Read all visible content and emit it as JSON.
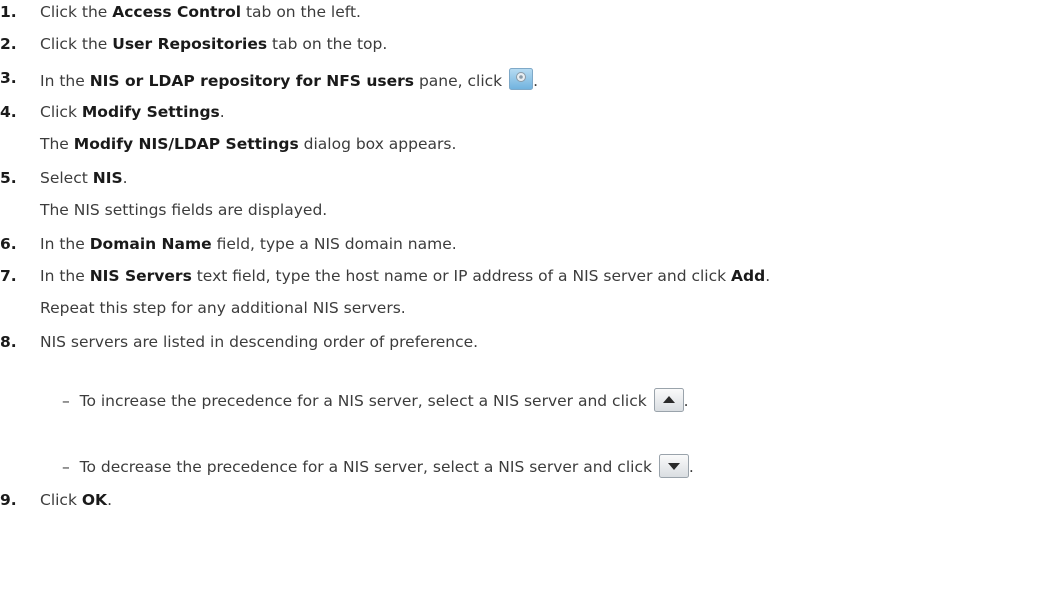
{
  "steps": [
    {
      "num": "1.",
      "pre": "Click the ",
      "bold": "Access Control",
      "post": " tab on the left."
    },
    {
      "num": "2.",
      "pre": "Click the ",
      "bold": "User Repositories",
      "post": " tab on the top."
    },
    {
      "num": "3.",
      "pre": "In the ",
      "bold": "NIS or LDAP repository for NFS users",
      "post": " pane, click ",
      "icon": "gear-icon",
      "after": "."
    },
    {
      "num": "4.",
      "pre": "Click ",
      "bold": "Modify Settings",
      "post": "."
    },
    {
      "num": "5.",
      "pre": "Select ",
      "bold": "NIS",
      "post": "."
    },
    {
      "num": "6.",
      "pre": "In the ",
      "bold": "Domain Name",
      "post": " field, type a NIS domain name."
    },
    {
      "num": "7.",
      "pre": "In the ",
      "bold": "NIS Servers",
      "post": " text field, type the host name or IP address of a NIS server and click ",
      "bold2": "Add",
      "post2": "."
    },
    {
      "num": "8.",
      "text": "NIS servers are listed in descending order of preference."
    },
    {
      "num": "9.",
      "pre": "Click ",
      "bold": "OK",
      "post": "."
    }
  ],
  "step4_result": {
    "pre": "The ",
    "bold": "Modify NIS/LDAP Settings",
    "post": " dialog box appears."
  },
  "step5_result": "The NIS settings fields are displayed.",
  "step7_note": "Repeat this step for any additional NIS servers.",
  "step8_bullets": [
    {
      "dash": "–",
      "text": "To increase the precedence for a NIS server, select a NIS server and click ",
      "icon": "arrow-up-icon",
      "after": "."
    },
    {
      "dash": "–",
      "text": "To decrease the precedence for a NIS server, select a NIS server and click ",
      "icon": "arrow-down-icon",
      "after": "."
    }
  ]
}
